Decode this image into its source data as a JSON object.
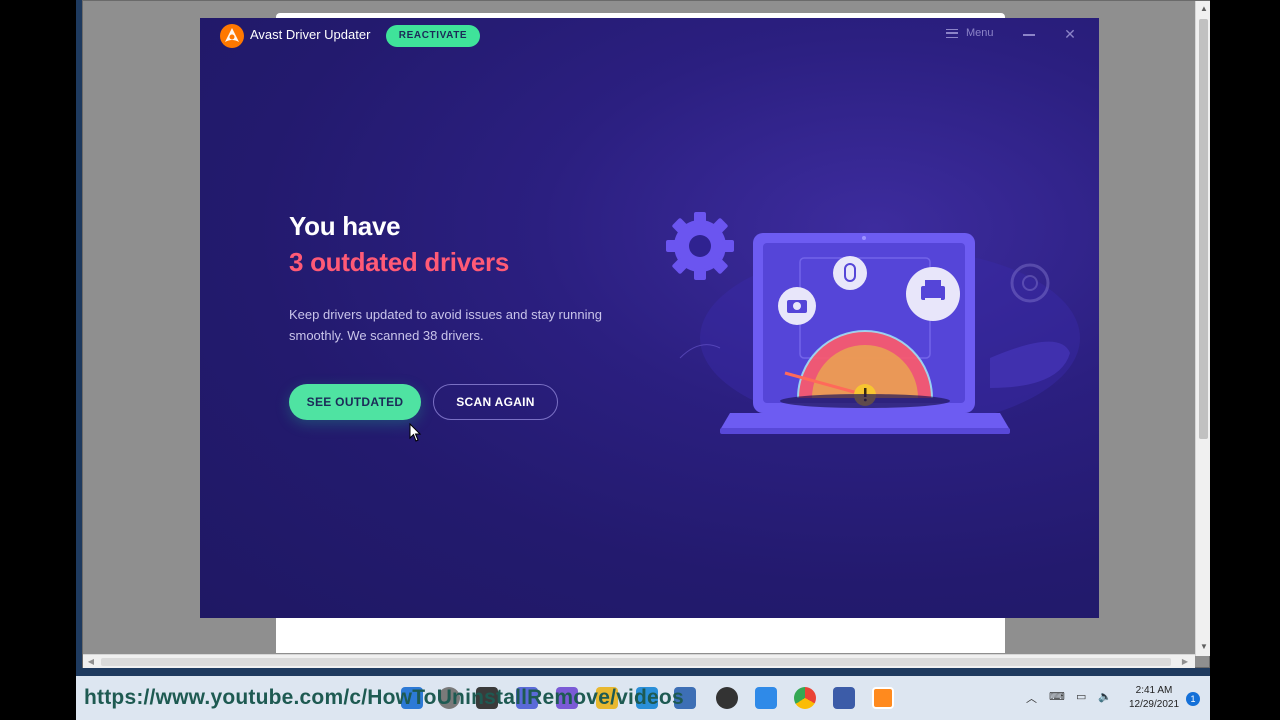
{
  "app": {
    "title": "Avast Driver Updater",
    "reactivate_label": "REACTIVATE",
    "menu_label": "Menu",
    "close_glyph": "✕"
  },
  "main": {
    "headline_line1": "You have",
    "headline_line2": "3 outdated drivers",
    "description": "Keep drivers updated to avoid issues and stay running smoothly. We scanned 38 drivers.",
    "see_outdated_label": "SEE OUTDATED",
    "scan_again_label": "SCAN AGAIN"
  },
  "overlay": {
    "url": "https://www.youtube.com/c/HowToUninstallRemove/videos"
  },
  "taskbar": {
    "time": "2:41 AM",
    "date": "12/29/2021",
    "notification_count": "1"
  },
  "colors": {
    "accent_green": "#4fe3a2",
    "alert_red": "#ff5a76",
    "bg_purple": "#2b1f80"
  },
  "icons": [
    "avast-logo-icon",
    "hamburger-icon",
    "minimize-icon",
    "close-icon",
    "gear-icon",
    "camera-icon",
    "mouse-icon",
    "printer-icon",
    "warning-icon"
  ]
}
